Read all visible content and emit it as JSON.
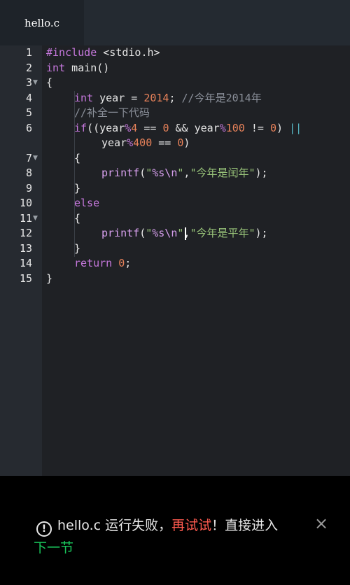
{
  "tab": {
    "label": "hello.c"
  },
  "editor": {
    "line_numbers": [
      "1",
      "2",
      "3",
      "4",
      "5",
      "6",
      "7",
      "8",
      "9",
      "10",
      "11",
      "12",
      "13",
      "14",
      "15"
    ],
    "code": {
      "l1": {
        "kw": "#include",
        "rest": " <stdio.h>"
      },
      "l2": {
        "kw": "int",
        "rest": " main()"
      },
      "l3": {
        "brace": "{"
      },
      "l4": {
        "kw": "int",
        "a": " year = ",
        "num": "2014",
        "b": "; ",
        "cmt": "//今年是2014年"
      },
      "l5": {
        "cmt": "//补全一下代码"
      },
      "l6": {
        "kw": "if",
        "a": "((year",
        "op1": "%",
        "n1": "4",
        "b": " == ",
        "n2": "0",
        "c": " && year",
        "op2": "%",
        "n3": "100",
        "d": " != ",
        "n4": "0",
        "e": ") ",
        "op3": "||"
      },
      "l6b": {
        "a": "year",
        "op": "%",
        "n1": "400",
        "b": " == ",
        "n2": "0",
        "c": ")"
      },
      "l7": {
        "brace": "{"
      },
      "l8": {
        "fn": "printf",
        "a": "(",
        "s1": "\"",
        "esc": "%s\\n",
        "s2": "\"",
        "b": ",",
        "s3": "\"今年是闰年\"",
        "c": ");"
      },
      "l9": {
        "brace": "}"
      },
      "l10": {
        "kw": "else"
      },
      "l11": {
        "brace": "{"
      },
      "l12": {
        "fn": "printf",
        "a": "(",
        "s1": "\"",
        "esc1": "%s\\n",
        "s2": "\"",
        "b": ",",
        "s3": "\"今年是平年\"",
        "c": ");"
      },
      "l13": {
        "brace": "}"
      },
      "l14": {
        "kw": "return",
        "num": " 0",
        "b": ";"
      },
      "l15": {
        "brace": "}"
      }
    }
  },
  "toast": {
    "icon": "alert-circle-icon",
    "message": "hello.c 运行失败，",
    "retry_label": "再试试",
    "after_retry": "！直接进入",
    "next_label": "下一节",
    "close_icon": "close-icon"
  },
  "colors": {
    "retry": "#ff5a4f",
    "next": "#19c55b",
    "keyword": "#c678dd",
    "number": "#e8825a",
    "string": "#98c379",
    "comment": "#8a8f99"
  }
}
